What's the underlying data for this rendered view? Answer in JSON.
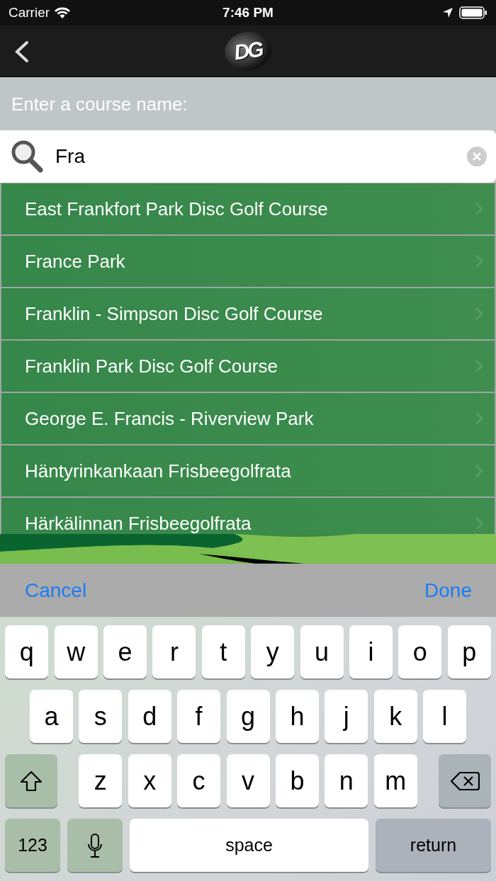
{
  "status_bar": {
    "carrier": "Carrier",
    "time": "7:46 PM"
  },
  "nav_bar": {
    "logo": "DG"
  },
  "search": {
    "label": "Enter a course name:",
    "value": "Fra"
  },
  "results": [
    {
      "name": "East Frankfort Park Disc Golf Course"
    },
    {
      "name": "France Park"
    },
    {
      "name": "Franklin - Simpson Disc Golf Course"
    },
    {
      "name": "Franklin Park Disc Golf Course"
    },
    {
      "name": "George E. Francis - Riverview Park"
    },
    {
      "name": "Häntyrinkankaan Frisbeegolfrata"
    },
    {
      "name": "Härkälinnan Frisbeegolfrata"
    }
  ],
  "toolbar": {
    "cancel": "Cancel",
    "done": "Done"
  },
  "keyboard": {
    "rows": [
      {
        "keys": [
          {
            "kind": "letter",
            "label": "q"
          },
          {
            "kind": "letter",
            "label": "w"
          },
          {
            "kind": "letter",
            "label": "e"
          },
          {
            "kind": "letter",
            "label": "r"
          },
          {
            "kind": "letter",
            "label": "t"
          },
          {
            "kind": "letter",
            "label": "y"
          },
          {
            "kind": "letter",
            "label": "u"
          },
          {
            "kind": "letter",
            "label": "i"
          },
          {
            "kind": "letter",
            "label": "o"
          },
          {
            "kind": "letter",
            "label": "p"
          }
        ]
      },
      {
        "keys": [
          {
            "kind": "letter",
            "label": "a"
          },
          {
            "kind": "letter",
            "label": "s"
          },
          {
            "kind": "letter",
            "label": "d"
          },
          {
            "kind": "letter",
            "label": "f"
          },
          {
            "kind": "letter",
            "label": "g"
          },
          {
            "kind": "letter",
            "label": "h"
          },
          {
            "kind": "letter",
            "label": "j"
          },
          {
            "kind": "letter",
            "label": "k"
          },
          {
            "kind": "letter",
            "label": "l"
          }
        ]
      },
      {
        "keys": [
          {
            "kind": "shift"
          },
          {
            "kind": "letter",
            "label": "z"
          },
          {
            "kind": "letter",
            "label": "x"
          },
          {
            "kind": "letter",
            "label": "c"
          },
          {
            "kind": "letter",
            "label": "v"
          },
          {
            "kind": "letter",
            "label": "b"
          },
          {
            "kind": "letter",
            "label": "n"
          },
          {
            "kind": "letter",
            "label": "m"
          },
          {
            "kind": "delete"
          }
        ]
      },
      {
        "keys": [
          {
            "kind": "numbers",
            "label": "123"
          },
          {
            "kind": "mic"
          },
          {
            "kind": "space",
            "label": "space"
          },
          {
            "kind": "return",
            "label": "return"
          }
        ]
      }
    ]
  }
}
